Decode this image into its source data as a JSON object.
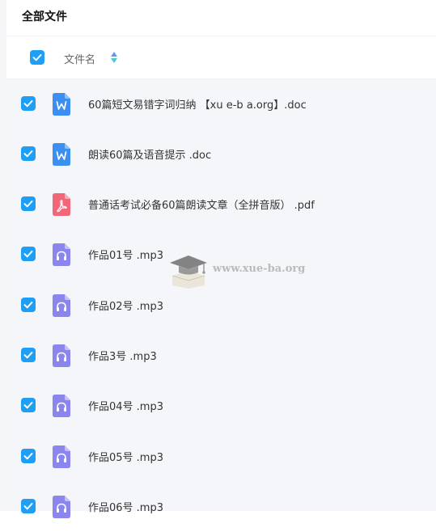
{
  "page": {
    "title": "全部文件"
  },
  "header": {
    "select_all_checked": true,
    "column_label": "文件名"
  },
  "colors": {
    "checkbox": "#1e9ef4",
    "doc_icon": "#3c8ef0",
    "pdf_icon": "#f2667a",
    "audio_icon": "#8b86ee"
  },
  "files": [
    {
      "name": "60篇短文易错字词归纳 【xu e-b a.org】.doc",
      "type": "doc",
      "icon": "word-doc-icon",
      "checked": true
    },
    {
      "name": "朗读60篇及语音提示 .doc",
      "type": "doc",
      "icon": "word-doc-icon",
      "checked": true
    },
    {
      "name": "普通话考试必备60篇朗读文章（全拼音版） .pdf",
      "type": "pdf",
      "icon": "pdf-icon",
      "checked": true
    },
    {
      "name": "作品01号 .mp3",
      "type": "audio",
      "icon": "audio-file-icon",
      "checked": true
    },
    {
      "name": "作品02号 .mp3",
      "type": "audio",
      "icon": "audio-file-icon",
      "checked": true
    },
    {
      "name": "作品3号 .mp3",
      "type": "audio",
      "icon": "audio-file-icon",
      "checked": true
    },
    {
      "name": "作品04号 .mp3",
      "type": "audio",
      "icon": "audio-file-icon",
      "checked": true
    },
    {
      "name": "作品05号 .mp3",
      "type": "audio",
      "icon": "audio-file-icon",
      "checked": true
    },
    {
      "name": "作品06号 .mp3",
      "type": "audio",
      "icon": "audio-file-icon",
      "checked": true
    }
  ],
  "watermark": {
    "text": "www.xue-ba.org"
  }
}
